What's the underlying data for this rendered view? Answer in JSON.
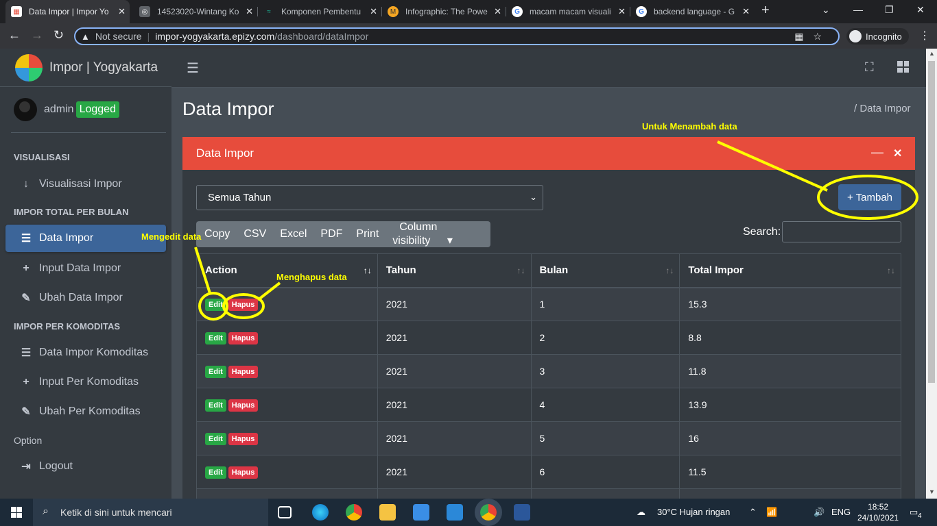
{
  "browser": {
    "tabs": [
      {
        "title": "Data Impor | Impor Yo",
        "active": true
      },
      {
        "title": "14523020-Wintang Ko"
      },
      {
        "title": "Komponen Pembentu"
      },
      {
        "title": "Infographic: The Powe"
      },
      {
        "title": "macam macam visuali"
      },
      {
        "title": "backend language - G"
      }
    ],
    "security_label": "Not secure",
    "url_host": "impor-yogyakarta.epizy.com",
    "url_path": "/dashboard/dataImpor",
    "incognito_label": "Incognito"
  },
  "sidebar": {
    "brand": "Impor | Yogyakarta",
    "user_name": "admin",
    "user_badge": "Logged",
    "sections": [
      {
        "header": "VISUALISASI"
      },
      {
        "header": "IMPOR TOTAL PER BULAN"
      },
      {
        "header": "IMPOR PER KOMODITAS"
      },
      {
        "header": "Option"
      }
    ],
    "items": [
      {
        "label": "Visualisasi Impor",
        "icon": "arrow-down-icon"
      },
      {
        "label": "Data Impor",
        "icon": "database-icon",
        "active": true
      },
      {
        "label": "Input Data Impor",
        "icon": "plus-icon"
      },
      {
        "label": "Ubah Data Impor",
        "icon": "edit-icon"
      },
      {
        "label": "Data Impor Komoditas",
        "icon": "database-icon"
      },
      {
        "label": "Input Per Komoditas",
        "icon": "plus-icon"
      },
      {
        "label": "Ubah Per Komoditas",
        "icon": "edit-icon"
      },
      {
        "label": "Logout",
        "icon": "logout-icon"
      }
    ]
  },
  "page": {
    "title": "Data Impor",
    "breadcrumb_sep": "/",
    "breadcrumb": "Data Impor"
  },
  "card": {
    "title": "Data Impor",
    "year_filter": "Semua Tahun",
    "add_button": "+ Tambah",
    "export_buttons": [
      "Copy",
      "CSV",
      "Excel",
      "PDF",
      "Print",
      "Column visibility"
    ],
    "search_label": "Search:",
    "columns": [
      "Action",
      "Tahun",
      "Bulan",
      "Total Impor"
    ],
    "edit_label": "Edit",
    "delete_label": "Hapus",
    "rows": [
      {
        "tahun": "2021",
        "bulan": "1",
        "total": "15.3"
      },
      {
        "tahun": "2021",
        "bulan": "2",
        "total": "8.8"
      },
      {
        "tahun": "2021",
        "bulan": "3",
        "total": "11.8"
      },
      {
        "tahun": "2021",
        "bulan": "4",
        "total": "13.9"
      },
      {
        "tahun": "2021",
        "bulan": "5",
        "total": "16"
      },
      {
        "tahun": "2021",
        "bulan": "6",
        "total": "11.5"
      }
    ]
  },
  "annotations": {
    "add": "Untuk Menambah data",
    "edit": "Mengedit data",
    "delete": "Menghapus data",
    "color": "#ffff00"
  },
  "taskbar": {
    "search_placeholder": "Ketik di sini untuk mencari",
    "weather": "30°C  Hujan ringan",
    "lang": "ENG",
    "time": "18:52",
    "date": "24/10/2021",
    "notifications": "4"
  },
  "colors": {
    "header_red": "#e74c3c",
    "primary_blue": "#3c6599",
    "success_green": "#28a745",
    "danger_red": "#dc3545"
  }
}
